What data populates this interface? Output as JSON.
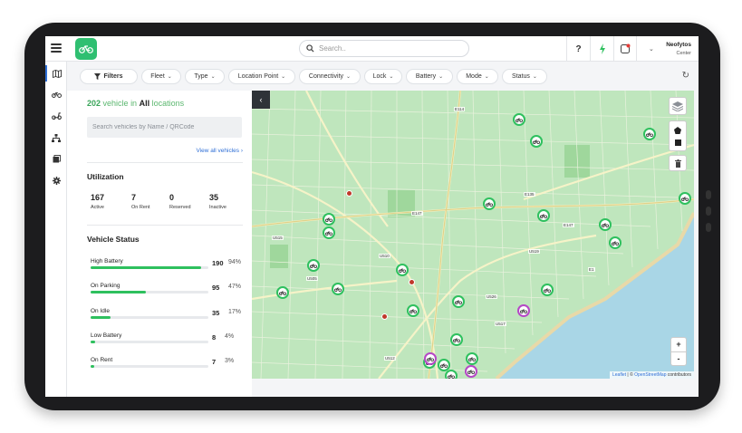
{
  "colors": {
    "brand": "#2fbf71",
    "accent": "#2f6fd6",
    "bar": "#2ec05e",
    "sea": "#a9d6e6",
    "map": "#bfe6bd"
  },
  "header": {
    "search_placeholder": "Search..",
    "help_label": "?",
    "user_name": "Neofytos",
    "user_role": "Center"
  },
  "filters": [
    "Filters",
    "Fleet",
    "Type",
    "Location Point",
    "Connectivity",
    "Lock",
    "Battery",
    "Mode",
    "Status"
  ],
  "panel": {
    "count": "202",
    "count_mid": "vehicle in",
    "count_all": "All",
    "count_tail": "locations",
    "search_placeholder": "Search vehicles by Name / QRCode",
    "view_all": "View all vehicles",
    "utilization_title": "Utilization",
    "utilization": [
      {
        "value": "167",
        "label": "Active"
      },
      {
        "value": "7",
        "label": "On Rent"
      },
      {
        "value": "0",
        "label": "Reserved"
      },
      {
        "value": "35",
        "label": "Inactive"
      }
    ],
    "status_title": "Vehicle Status",
    "statuses": [
      {
        "label": "High Battery",
        "count": "190",
        "pct": "94%",
        "fill": 0.94
      },
      {
        "label": "On Parking",
        "count": "95",
        "pct": "47%",
        "fill": 0.47
      },
      {
        "label": "On Idle",
        "count": "35",
        "pct": "17%",
        "fill": 0.17
      },
      {
        "label": "Low Battery",
        "count": "8",
        "pct": "4%",
        "fill": 0.04
      },
      {
        "label": "On Rent",
        "count": "7",
        "pct": "3%",
        "fill": 0.03
      }
    ]
  },
  "map": {
    "collapse_icon": "chevron-left-icon",
    "zoom_in": "+",
    "zoom_out": "-",
    "attribution_link1": "Leaflet",
    "attribution_sep": " | © ",
    "attribution_link2": "OpenStreetMap",
    "attribution_tail": " contributors",
    "labels": [
      "E114",
      "E147",
      "E147",
      "E135",
      "E1",
      "U515",
      "U510",
      "U519",
      "U526",
      "U517",
      "U512",
      "U505"
    ]
  }
}
